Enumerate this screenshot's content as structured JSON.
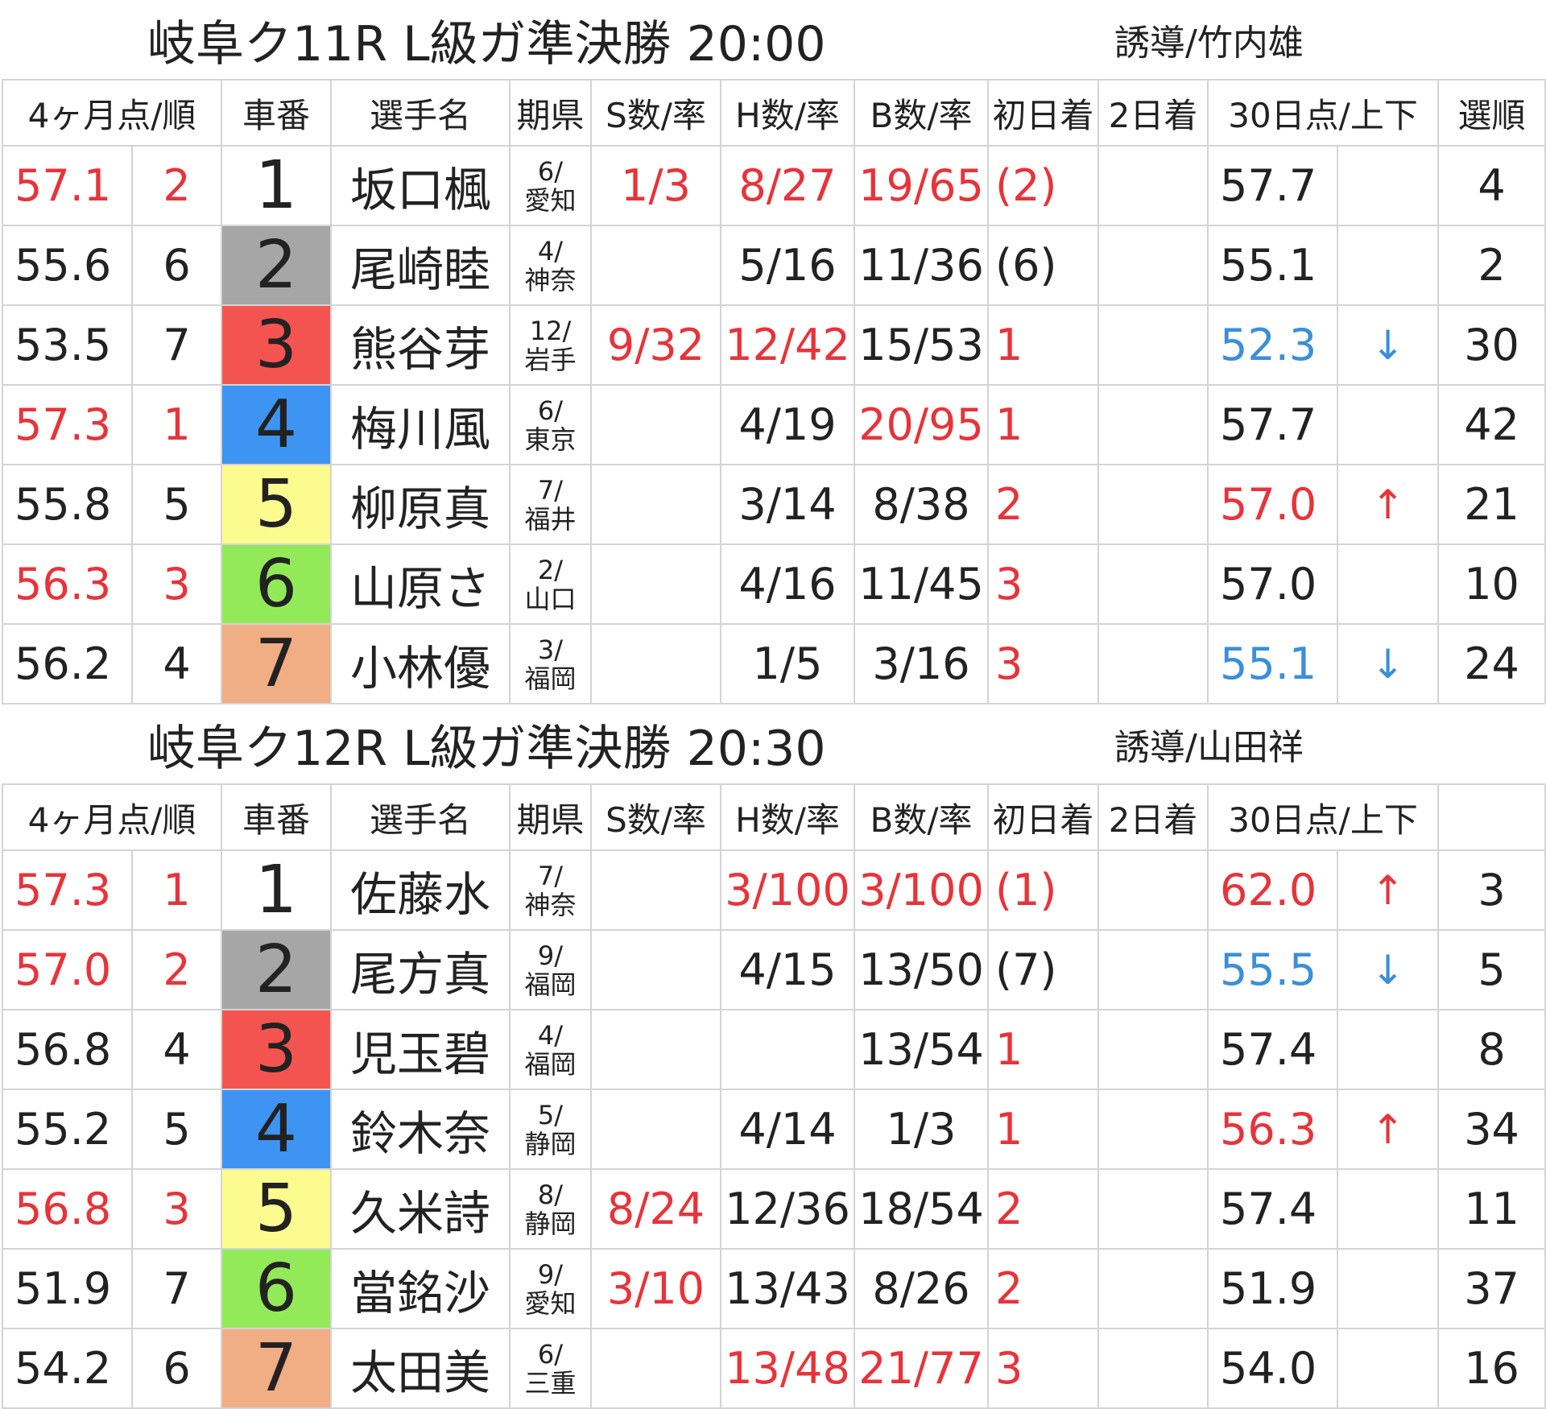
{
  "races": [
    {
      "title": "岐阜ク11R L級ガ準決勝 20:00",
      "guide": "誘導/竹内雄",
      "headers": [
        "4ヶ月点/順",
        "車番",
        "選手名",
        "期県",
        "S数/率",
        "H数/率",
        "B数/率",
        "初日着",
        "2日着",
        "30日点/上下",
        "選順"
      ],
      "rows": [
        {
          "pts": "57.1",
          "rank": "2",
          "car": "1",
          "name": "坂口楓",
          "term": "6/",
          "pref": "愛知",
          "s": "1/3",
          "h": "8/27",
          "b": "19/65",
          "d1": "(2)",
          "d2": "",
          "p30": "57.7",
          "arrow": "",
          "sel": "4",
          "pts_red": true,
          "s_red": true,
          "h_red": true,
          "b_red": true,
          "d1_red": true,
          "p30_color": "",
          "arrow_color": ""
        },
        {
          "pts": "55.6",
          "rank": "6",
          "car": "2",
          "name": "尾崎睦",
          "term": "4/",
          "pref": "神奈",
          "s": "",
          "h": "5/16",
          "b": "11/36",
          "d1": "(6)",
          "d2": "",
          "p30": "55.1",
          "arrow": "",
          "sel": "2",
          "pts_red": false,
          "s_red": false,
          "h_red": false,
          "b_red": false,
          "d1_red": false,
          "p30_color": "",
          "arrow_color": ""
        },
        {
          "pts": "53.5",
          "rank": "7",
          "car": "3",
          "name": "熊谷芽",
          "term": "12/",
          "pref": "岩手",
          "s": "9/32",
          "h": "12/42",
          "b": "15/53",
          "d1": "1",
          "d2": "",
          "p30": "52.3",
          "arrow": "↓",
          "sel": "30",
          "pts_red": false,
          "s_red": true,
          "h_red": true,
          "b_red": false,
          "d1_red": true,
          "p30_color": "blue",
          "arrow_color": "blue"
        },
        {
          "pts": "57.3",
          "rank": "1",
          "car": "4",
          "name": "梅川風",
          "term": "6/",
          "pref": "東京",
          "s": "",
          "h": "4/19",
          "b": "20/95",
          "d1": "1",
          "d2": "",
          "p30": "57.7",
          "arrow": "",
          "sel": "42",
          "pts_red": true,
          "s_red": false,
          "h_red": false,
          "b_red": true,
          "d1_red": true,
          "p30_color": "",
          "arrow_color": ""
        },
        {
          "pts": "55.8",
          "rank": "5",
          "car": "5",
          "name": "柳原真",
          "term": "7/",
          "pref": "福井",
          "s": "",
          "h": "3/14",
          "b": "8/38",
          "d1": "2",
          "d2": "",
          "p30": "57.0",
          "arrow": "↑",
          "sel": "21",
          "pts_red": false,
          "s_red": false,
          "h_red": false,
          "b_red": false,
          "d1_red": true,
          "p30_color": "red",
          "arrow_color": "red"
        },
        {
          "pts": "56.3",
          "rank": "3",
          "car": "6",
          "name": "山原さ",
          "term": "2/",
          "pref": "山口",
          "s": "",
          "h": "4/16",
          "b": "11/45",
          "d1": "3",
          "d2": "",
          "p30": "57.0",
          "arrow": "",
          "sel": "10",
          "pts_red": true,
          "s_red": false,
          "h_red": false,
          "b_red": false,
          "d1_red": true,
          "p30_color": "",
          "arrow_color": ""
        },
        {
          "pts": "56.2",
          "rank": "4",
          "car": "7",
          "name": "小林優",
          "term": "3/",
          "pref": "福岡",
          "s": "",
          "h": "1/5",
          "b": "3/16",
          "d1": "3",
          "d2": "",
          "p30": "55.1",
          "arrow": "↓",
          "sel": "24",
          "pts_red": false,
          "s_red": false,
          "h_red": false,
          "b_red": false,
          "d1_red": true,
          "p30_color": "blue",
          "arrow_color": "blue"
        }
      ]
    },
    {
      "title": "岐阜ク12R L級ガ準決勝 20:30",
      "guide": "誘導/山田祥",
      "headers": [
        "4ヶ月点/順",
        "車番",
        "選手名",
        "期県",
        "S数/率",
        "H数/率",
        "B数/率",
        "初日着",
        "2日着",
        "30日点/上下",
        ""
      ],
      "rows": [
        {
          "pts": "57.3",
          "rank": "1",
          "car": "1",
          "name": "佐藤水",
          "term": "7/",
          "pref": "神奈",
          "s": "",
          "h": "3/100",
          "b": "3/100",
          "d1": "(1)",
          "d2": "",
          "p30": "62.0",
          "arrow": "↑",
          "sel": "3",
          "pts_red": true,
          "s_red": false,
          "h_red": true,
          "b_red": true,
          "d1_red": true,
          "p30_color": "red",
          "arrow_color": "red"
        },
        {
          "pts": "57.0",
          "rank": "2",
          "car": "2",
          "name": "尾方真",
          "term": "9/",
          "pref": "福岡",
          "s": "",
          "h": "4/15",
          "b": "13/50",
          "d1": "(7)",
          "d2": "",
          "p30": "55.5",
          "arrow": "↓",
          "sel": "5",
          "pts_red": true,
          "s_red": false,
          "h_red": false,
          "b_red": false,
          "d1_red": false,
          "p30_color": "blue",
          "arrow_color": "blue"
        },
        {
          "pts": "56.8",
          "rank": "4",
          "car": "3",
          "name": "児玉碧",
          "term": "4/",
          "pref": "福岡",
          "s": "",
          "h": "",
          "b": "13/54",
          "d1": "1",
          "d2": "",
          "p30": "57.4",
          "arrow": "",
          "sel": "8",
          "pts_red": false,
          "s_red": false,
          "h_red": false,
          "b_red": false,
          "d1_red": true,
          "p30_color": "",
          "arrow_color": ""
        },
        {
          "pts": "55.2",
          "rank": "5",
          "car": "4",
          "name": "鈴木奈",
          "term": "5/",
          "pref": "静岡",
          "s": "",
          "h": "4/14",
          "b": "1/3",
          "d1": "1",
          "d2": "",
          "p30": "56.3",
          "arrow": "↑",
          "sel": "34",
          "pts_red": false,
          "s_red": false,
          "h_red": false,
          "b_red": false,
          "d1_red": true,
          "p30_color": "red",
          "arrow_color": "red"
        },
        {
          "pts": "56.8",
          "rank": "3",
          "car": "5",
          "name": "久米詩",
          "term": "8/",
          "pref": "静岡",
          "s": "8/24",
          "h": "12/36",
          "b": "18/54",
          "d1": "2",
          "d2": "",
          "p30": "57.4",
          "arrow": "",
          "sel": "11",
          "pts_red": true,
          "s_red": true,
          "h_red": false,
          "b_red": false,
          "d1_red": true,
          "p30_color": "",
          "arrow_color": ""
        },
        {
          "pts": "51.9",
          "rank": "7",
          "car": "6",
          "name": "當銘沙",
          "term": "9/",
          "pref": "愛知",
          "s": "3/10",
          "h": "13/43",
          "b": "8/26",
          "d1": "2",
          "d2": "",
          "p30": "51.9",
          "arrow": "",
          "sel": "37",
          "pts_red": false,
          "s_red": true,
          "h_red": false,
          "b_red": false,
          "d1_red": true,
          "p30_color": "",
          "arrow_color": ""
        },
        {
          "pts": "54.2",
          "rank": "6",
          "car": "7",
          "name": "太田美",
          "term": "6/",
          "pref": "三重",
          "s": "",
          "h": "13/48",
          "b": "21/77",
          "d1": "3",
          "d2": "",
          "p30": "54.0",
          "arrow": "",
          "sel": "16",
          "pts_red": false,
          "s_red": false,
          "h_red": true,
          "b_red": true,
          "d1_red": true,
          "p30_color": "",
          "arrow_color": ""
        }
      ]
    }
  ],
  "colors": {
    "car_1": "#ffffff",
    "car_2": "#a6a6a6",
    "car_3": "#f4544f",
    "car_4": "#3e94f2",
    "car_5": "#fcfb8f",
    "car_6": "#93ea58",
    "car_7": "#f1ad84",
    "red_text": "#e8333a",
    "blue_text": "#3b8fd8"
  }
}
